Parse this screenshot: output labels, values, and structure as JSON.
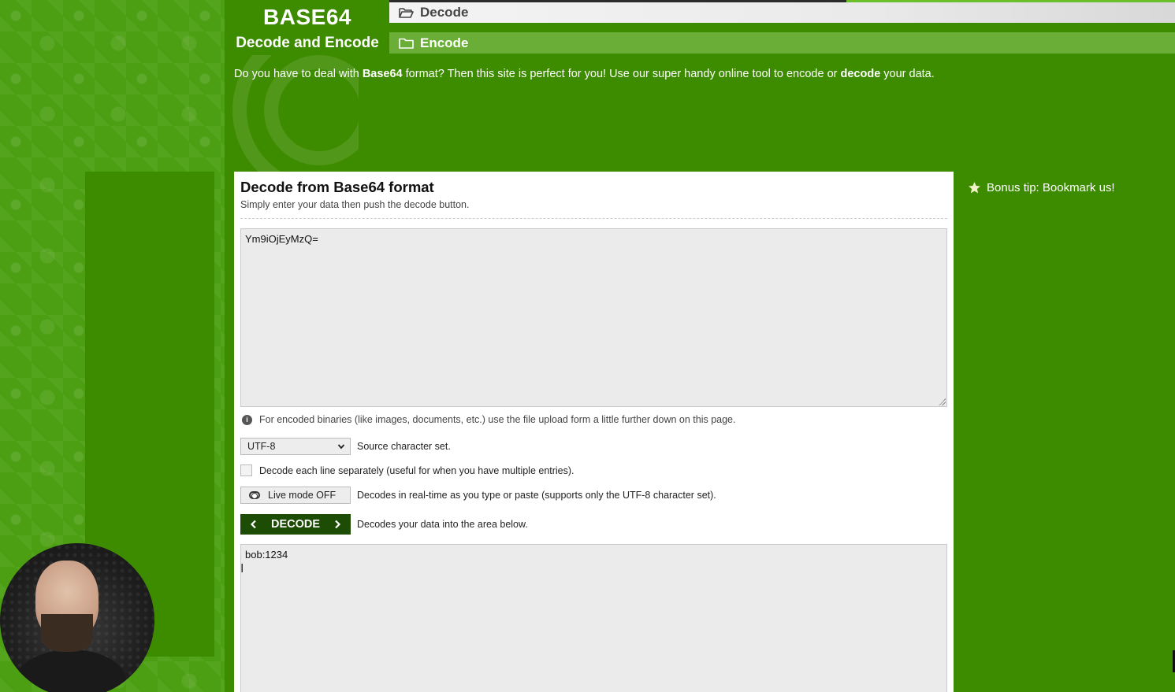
{
  "brand": {
    "title": "BASE64",
    "subtitle": "Decode and Encode"
  },
  "nav": {
    "decode_label": "Decode",
    "encode_label": "Encode"
  },
  "intro": {
    "part1": "Do you have to deal with ",
    "bold1": "Base64",
    "part2": " format? Then this site is perfect for you! Use our super handy online tool to encode or ",
    "bold2": "decode",
    "part3": " your data."
  },
  "card": {
    "title": "Decode from Base64 format",
    "subtitle": "Simply enter your data then push the decode button.",
    "input_value": "Ym9iOjEyMzQ=",
    "info_text": "For encoded binaries (like images, documents, etc.) use the file upload form a little further down on this page.",
    "charset_value": "UTF-8",
    "charset_label": "Source character set.",
    "lines_label": "Decode each line separately (useful for when you have multiple entries).",
    "live_label": "Live mode OFF",
    "live_desc": "Decodes in real-time as you type or paste (supports only the UTF-8 character set).",
    "decode_button": "DECODE",
    "decode_desc": "Decodes your data into the area below.",
    "output_value": "bob:1234"
  },
  "sidebar": {
    "bonus_tip": "Bonus tip: Bookmark us!"
  },
  "icons": {
    "nav": "folder-icon",
    "info": "info-icon",
    "bonus": "star-icon",
    "live": "toggle-icon"
  },
  "colors": {
    "page_green": "#3d8c00",
    "decode_button": "#1d4d05",
    "encode_tab": "#6aad37"
  }
}
